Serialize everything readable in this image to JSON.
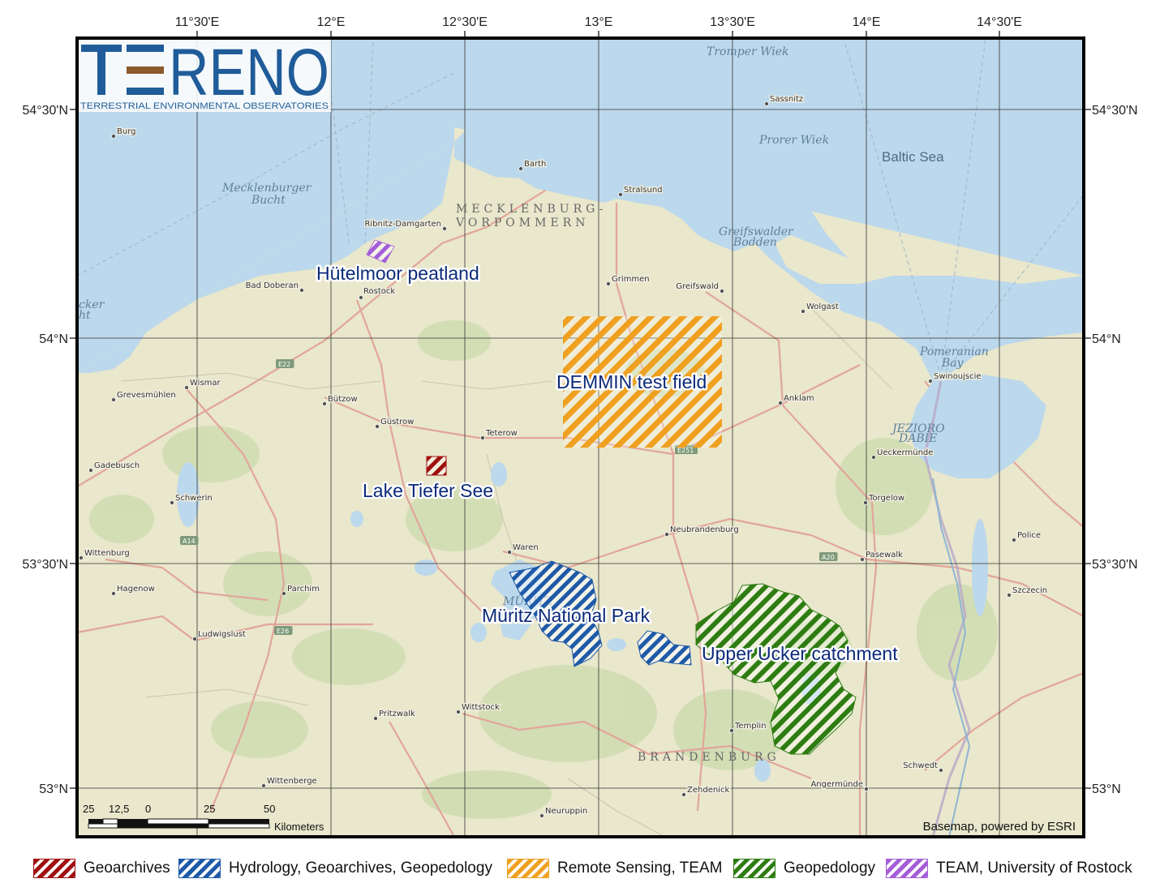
{
  "logo": {
    "title": "TERENO",
    "subtitle": "TERRESTRIAL ENVIRONMENTAL OBSERVATORIES"
  },
  "axes": {
    "lon_labels": [
      "11°30'E",
      "12°E",
      "12°30'E",
      "13°E",
      "13°30'E",
      "14°E",
      "14°30'E"
    ],
    "lat_labels": [
      "54°30'N",
      "54°N",
      "53°30'N",
      "53°N"
    ]
  },
  "sites": {
    "hutelmoor": {
      "label": "Hütelmoor peatland",
      "category": "TEAM, University of Rostock"
    },
    "demmin": {
      "label": "DEMMIN test field",
      "category": "Remote Sensing, TEAM"
    },
    "tiefer_see": {
      "label": "Lake Tiefer See",
      "category": "Geoarchives"
    },
    "muritz": {
      "label": "Müritz National Park",
      "category": "Hydrology, Geoarchives, Geopedology"
    },
    "ucker": {
      "label": "Upper Ucker catchment",
      "category": "Geopedology"
    }
  },
  "basemap": {
    "seas": {
      "baltic": "Baltic Sea",
      "mecklenburger_1": "Mecklenburger",
      "mecklenburger_2": "Bucht",
      "tromper": "Tromper Wiek",
      "prorer": "Prorer Wiek",
      "greifswalder_1": "Greifswalder",
      "greifswalder_2": "Bodden",
      "pomeranian_1": "Pomeranian",
      "pomeranian_2": "Bay",
      "dabie_1": "JEZIORO",
      "dabie_2": "DABIE",
      "muritz_lake": "MÜRITZ",
      "edge_1": "cker",
      "edge_2": "ht"
    },
    "regions": {
      "mv_1": "MECKLENBURG-",
      "mv_2": "VORPOMMERN",
      "brandenburg": "BRANDENBURG"
    },
    "cities": [
      "Burg",
      "Sassnitz",
      "Barth",
      "Stralsund",
      "Ribnitz-Damgarten",
      "Rostock",
      "Bad Doberan",
      "Grimmen",
      "Greifswald",
      "Wolgast",
      "Wismar",
      "Grevesmühlen",
      "Bützow",
      "Güstrow",
      "Teterow",
      "Anklam",
      "Swinoujscie",
      "Ueckermünde",
      "Gadebusch",
      "Schwerin",
      "Torgelow",
      "Neubrandenburg",
      "Police",
      "Waren",
      "Wittenburg",
      "Pasewalk",
      "Hagenow",
      "Parchim",
      "Szczecin",
      "Ludwigslust",
      "Pritzwalk",
      "Wittstock",
      "Templin",
      "Schwedt",
      "Wittenberge",
      "Angermünde",
      "Zehdenick",
      "Neuruppin"
    ],
    "roads": [
      "E22",
      "E251",
      "A14",
      "A20",
      "E26"
    ],
    "attribution": "Basemap, powered by ESRI"
  },
  "scale_bar": {
    "ticks": [
      "25",
      "12,5",
      "0",
      "25",
      "50"
    ],
    "unit": "Kilometers"
  },
  "legend": [
    {
      "label": "Geoarchives",
      "color": "#a01010"
    },
    {
      "label": "Hydrology, Geoarchives, Geopedology",
      "color": "#1f5aa8"
    },
    {
      "label": "Remote Sensing, TEAM",
      "color": "#f0a020"
    },
    {
      "label": "Geopedology",
      "color": "#2e7d12"
    },
    {
      "label": "TEAM, University of Rostock",
      "color": "#a45ed8"
    }
  ],
  "colors": {
    "sea": "#bcd8ec",
    "land": "#e9e7cc",
    "frame": "#000000",
    "label_text": "#0b2a7a",
    "tereno_blue": "#1f5c99",
    "tereno_brown": "#8a5a2b"
  }
}
